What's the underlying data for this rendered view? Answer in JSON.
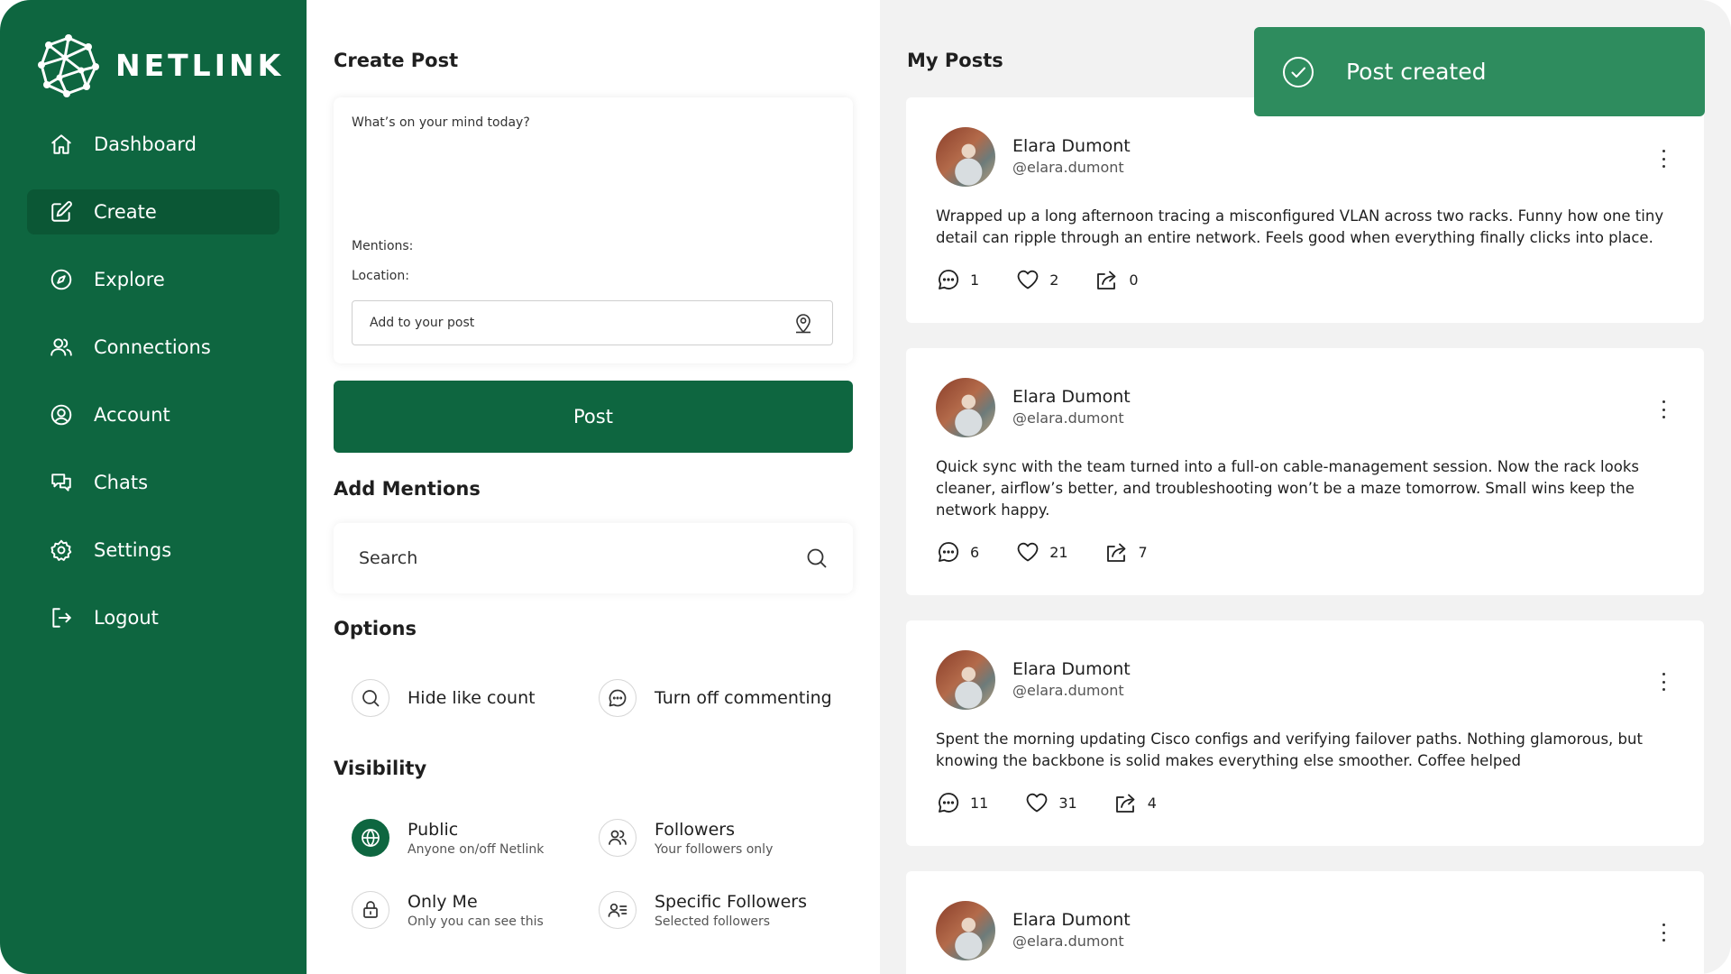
{
  "brand": {
    "name": "NETLINK",
    "logo_icon": "network-globe-icon"
  },
  "sidebar": {
    "items": [
      {
        "label": "Dashboard",
        "icon": "home-icon",
        "active": false
      },
      {
        "label": "Create",
        "icon": "edit-icon",
        "active": true
      },
      {
        "label": "Explore",
        "icon": "compass-icon",
        "active": false
      },
      {
        "label": "Connections",
        "icon": "users-icon",
        "active": false
      },
      {
        "label": "Account",
        "icon": "user-circle-icon",
        "active": false
      },
      {
        "label": "Chats",
        "icon": "chat-icon",
        "active": false
      },
      {
        "label": "Settings",
        "icon": "gear-icon",
        "active": false
      },
      {
        "label": "Logout",
        "icon": "logout-icon",
        "active": false
      }
    ]
  },
  "create": {
    "title": "Create Post",
    "compose_placeholder": "What’s on your mind today?",
    "mentions_label": "Mentions:",
    "location_label": "Location:",
    "add_to_post_label": "Add to your post",
    "post_button": "Post",
    "mentions_title": "Add Mentions",
    "search_placeholder": "Search",
    "options_title": "Options",
    "options": [
      {
        "label": "Hide like count",
        "icon": "search-icon"
      },
      {
        "label": "Turn off commenting",
        "icon": "comment-icon"
      }
    ],
    "visibility_title": "Visibility",
    "visibility": [
      {
        "title": "Public",
        "subtitle": "Anyone on/off Netlink",
        "icon": "globe-icon",
        "selected": true
      },
      {
        "title": "Followers",
        "subtitle": "Your followers only",
        "icon": "users-icon",
        "selected": false
      },
      {
        "title": "Only Me",
        "subtitle": "Only you can see this",
        "icon": "lock-icon",
        "selected": false
      },
      {
        "title": "Specific Followers",
        "subtitle": "Selected followers",
        "icon": "user-list-icon",
        "selected": false
      }
    ]
  },
  "posts": {
    "title": "My Posts",
    "items": [
      {
        "author": "Elara Dumont",
        "handle": "@elara.dumont",
        "text": "Wrapped up a long afternoon tracing a misconfigured VLAN across two racks. Funny how one tiny detail can ripple through an entire network. Feels good when everything finally clicks into place.",
        "comments": "1",
        "likes": "2",
        "shares": "0"
      },
      {
        "author": "Elara Dumont",
        "handle": "@elara.dumont",
        "text": "Quick sync with the team turned into a full-on cable-management session. Now the rack looks cleaner, airflow’s better, and troubleshooting won’t be a maze tomorrow. Small wins keep the network happy.",
        "comments": "6",
        "likes": "21",
        "shares": "7"
      },
      {
        "author": "Elara Dumont",
        "handle": "@elara.dumont",
        "text": "Spent the morning updating Cisco configs and verifying failover paths. Nothing glamorous, but knowing the backbone is solid makes everything else smoother. Coffee helped",
        "comments": "11",
        "likes": "31",
        "shares": "4"
      },
      {
        "author": "Elara Dumont",
        "handle": "@elara.dumont",
        "text": "",
        "comments": "",
        "likes": "",
        "shares": ""
      }
    ]
  },
  "toast": {
    "message": "Post created",
    "icon": "check-circle-icon"
  },
  "colors": {
    "primary": "#0e6640",
    "toast": "#2e8c5e",
    "panel": "#f2f2f2"
  }
}
